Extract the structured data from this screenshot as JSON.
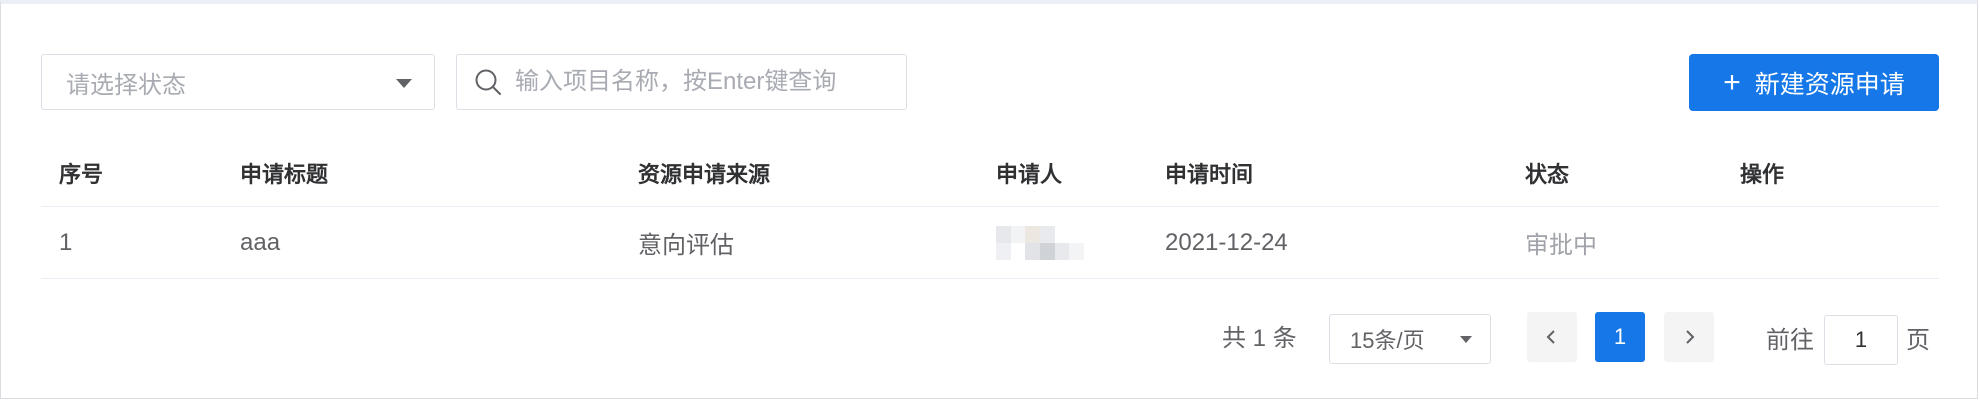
{
  "filters": {
    "status_placeholder": "请选择状态",
    "search_placeholder": "输入项目名称，按Enter键查询",
    "new_button_label": "新建资源申请",
    "new_button_icon": "+"
  },
  "table": {
    "columns": [
      "序号",
      "申请标题",
      "资源申请来源",
      "申请人",
      "申请时间",
      "状态",
      "操作"
    ],
    "rows": [
      {
        "index": "1",
        "title": "aaa",
        "source": "意向评估",
        "applicant": "",
        "date": "2021-12-24",
        "status": "审批中",
        "actions": ""
      }
    ]
  },
  "pagination": {
    "total_text": "共 1 条",
    "page_size": "15条/页",
    "current_page": "1",
    "goto_label": "前往",
    "goto_value": "1",
    "goto_unit": "页"
  },
  "colors": {
    "primary": "#1677e8",
    "status_pending": "#a0a3a9"
  }
}
